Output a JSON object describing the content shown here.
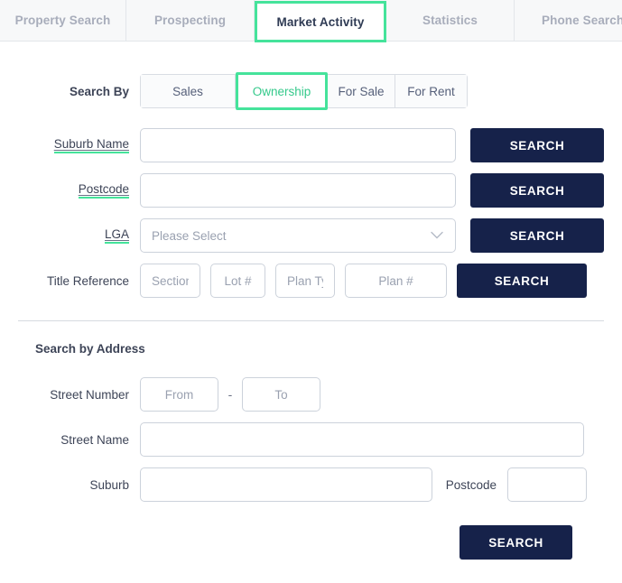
{
  "tabs": [
    {
      "label": "Property Search",
      "active": false
    },
    {
      "label": "Prospecting",
      "active": false
    },
    {
      "label": "Market Activity",
      "active": true
    },
    {
      "label": "Statistics",
      "active": false
    },
    {
      "label": "Phone Search",
      "active": false
    }
  ],
  "search_by": {
    "label": "Search By",
    "options": [
      {
        "label": "Sales",
        "active": false
      },
      {
        "label": "Ownership",
        "active": true
      },
      {
        "label": "For Sale",
        "active": false
      },
      {
        "label": "For Rent",
        "active": false
      }
    ]
  },
  "rows": {
    "suburb_name": {
      "label": "Suburb Name",
      "value": "",
      "placeholder": "",
      "button": "SEARCH"
    },
    "postcode": {
      "label": "Postcode",
      "value": "",
      "placeholder": "",
      "button": "SEARCH"
    },
    "lga": {
      "label": "LGA",
      "value": "Please Select",
      "button": "SEARCH"
    },
    "title_reference": {
      "label": "Title Reference",
      "button": "SEARCH",
      "fields": [
        {
          "placeholder": "Section",
          "value": ""
        },
        {
          "placeholder": "Lot #",
          "value": ""
        },
        {
          "placeholder": "Plan Type",
          "value": ""
        },
        {
          "placeholder": "Plan #",
          "value": ""
        }
      ]
    }
  },
  "address_section": {
    "title": "Search by Address",
    "street_number": {
      "label": "Street Number",
      "from": {
        "placeholder": "From",
        "value": ""
      },
      "separator": "-",
      "to": {
        "placeholder": "To",
        "value": ""
      }
    },
    "street_name": {
      "label": "Street Name",
      "value": "",
      "placeholder": ""
    },
    "suburb": {
      "label": "Suburb",
      "value": "",
      "placeholder": ""
    },
    "postcode": {
      "label": "Postcode",
      "value": "",
      "placeholder": ""
    },
    "button": "SEARCH"
  },
  "colors": {
    "accent_green": "#45e39b",
    "navy": "#16224a",
    "tab_inactive_bg": "#f7f8f9",
    "border_grey": "#ccd2db"
  },
  "icons": {
    "chevron_down": "chevron-down-icon"
  }
}
